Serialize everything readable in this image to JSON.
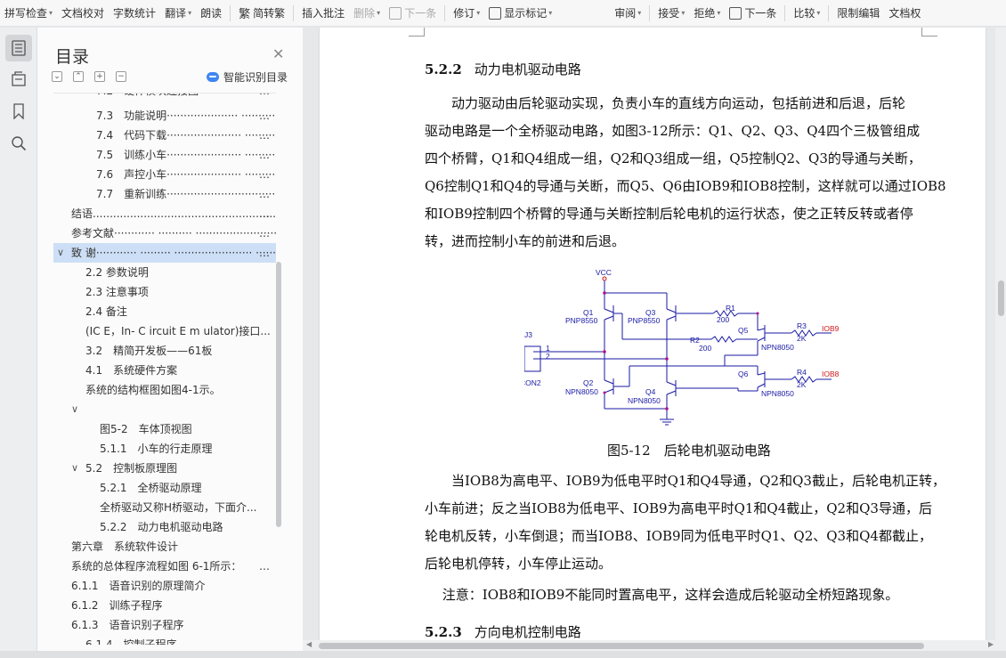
{
  "toolbar": {
    "items": [
      {
        "label": "拼写检查",
        "dropdown": true
      },
      {
        "label": "文档校对",
        "dropdown": false
      },
      {
        "label": "字数统计",
        "dropdown": false
      },
      {
        "label": "翻译",
        "dropdown": true
      },
      {
        "label": "朗读",
        "dropdown": false
      },
      {
        "label": "简转繁",
        "dropdown": false
      },
      {
        "label": "插入批注",
        "dropdown": false
      },
      {
        "label": "删除",
        "dropdown": true
      },
      {
        "label": "下一条",
        "dropdown": false
      },
      {
        "label": "修订",
        "dropdown": true
      },
      {
        "label": "显示标记",
        "dropdown": true
      },
      {
        "label": "审阅",
        "dropdown": true
      },
      {
        "label": "接受",
        "dropdown": true
      },
      {
        "label": "拒绝",
        "dropdown": true
      },
      {
        "label": "下一条",
        "dropdown": false
      },
      {
        "label": "比较",
        "dropdown": true
      },
      {
        "label": "限制编辑",
        "dropdown": false
      },
      {
        "label": "文档权",
        "dropdown": false
      }
    ]
  },
  "rail": {
    "buttons": [
      "toc-icon",
      "navigation-icon",
      "bookmark-icon",
      "search-icon"
    ]
  },
  "toc": {
    "title": "目录",
    "smart_label": "智能识别目录",
    "items": [
      {
        "label": "7.2　硬件模块连接图",
        "dots": "…"
      },
      {
        "label": "7.3　功能说明·····················  ··········",
        "dots": "…"
      },
      {
        "label": "7.4　代码下载······················  ··········",
        "dots": "…"
      },
      {
        "label": "7.5　训练小车······················  ··········",
        "dots": "…"
      },
      {
        "label": "7.6　声控小车······················  ··········",
        "dots": "…"
      },
      {
        "label": "7.7　重新训练··································",
        "dots": "…"
      },
      {
        "label": "结语...........................................................",
        "dots": "…"
      },
      {
        "label": "参考文献············  ··········  ··························",
        "dots": "…"
      },
      {
        "label": "致  谢············  ·········  ·······················  ·········",
        "dots": "…"
      },
      {
        "label": "2.2  参数说明",
        "dots": ""
      },
      {
        "label": "2.3  注意事项",
        "dots": ""
      },
      {
        "label": "2.4  备注",
        "dots": ""
      },
      {
        "label": "(IC E，In- C ircuit E m ulator)接口...",
        "dots": ""
      },
      {
        "label": "3.2　精简开发板——61板",
        "dots": ""
      },
      {
        "label": "4.1　系统硬件方案",
        "dots": ""
      },
      {
        "label": "系统的结构框图如图4-1示。",
        "dots": ""
      },
      {
        "label": "",
        "dots": ""
      },
      {
        "label": "图5-2　车体顶视图",
        "dots": ""
      },
      {
        "label": "5.1.1　小车的行走原理",
        "dots": ""
      },
      {
        "label": "5.2　控制板原理图",
        "dots": ""
      },
      {
        "label": "5.2.1　全桥驱动原理",
        "dots": ""
      },
      {
        "label": "全桥驱动又称H桥驱动，下面介...",
        "dots": ""
      },
      {
        "label": "5.2.2　动力电机驱动电路",
        "dots": ""
      },
      {
        "label": "第六章　系统软件设计",
        "dots": ""
      },
      {
        "label": "系统的总体程序流程如图 6-1所示：",
        "dots": "…"
      },
      {
        "label": "6.1.1　语音识别的原理简介",
        "dots": ""
      },
      {
        "label": "6.1.2　训练子程序",
        "dots": ""
      },
      {
        "label": "6.1.3　语音识别子程序",
        "dots": ""
      },
      {
        "label": "6.1.4　控制子程序",
        "dots": ""
      }
    ]
  },
  "document": {
    "heading_522": {
      "num": "5.2.2",
      "text": "动力电机驱动电路"
    },
    "para1": [
      "　　动力驱动由后轮驱动实现，负责小车的直线方向运动，包括前进和后退，后轮",
      "驱动电路是一个全桥驱动电路，如图3-12所示：Q1、Q2、Q3、Q4四个三极管组成",
      "四个桥臂，Q1和Q4组成一组，Q2和Q3组成一组，Q5控制Q2、Q3的导通与关断，",
      "Q6控制Q1和Q4的导通与关断，而Q5、Q6由IOB9和IOB8控制，这样就可以通过IOB8",
      "和IOB9控制四个桥臂的导通与关断控制后轮电机的运行状态，使之正转反转或者停",
      "转，进而控制小车的前进和后退。"
    ],
    "figure_caption": "图5-12　后轮电机驱动电路",
    "circuit_labels": {
      "vcc": "VCC",
      "j3": "J3",
      "con2": "CON2",
      "pin1": "1",
      "pin2": "2",
      "q1": "Q1",
      "q1_type": "PNP8550",
      "q3": "Q3",
      "q3_type": "PNP8550",
      "q2": "Q2",
      "q2_type": "NPN8050",
      "q4": "Q4",
      "q4_type": "NPN8050",
      "q5": "Q5",
      "q5_type": "NPN8050",
      "q6": "Q6",
      "q6_type": "NPN8050",
      "r1": "R1",
      "r1_val": "200",
      "r2": "R2",
      "r2_val": "200",
      "r3": "R3",
      "r3_val": "2K",
      "r4": "R4",
      "r4_val": "2K",
      "iob9": "IOB9",
      "iob8": "IOB8"
    },
    "para2": [
      "　　当IOB8为高电平、IOB9为低电平时Q1和Q4导通，Q2和Q3截止，后轮电机正转，",
      "小车前进；反之当IOB8为低电平、IOB9为高电平时Q1和Q4截止，Q2和Q3导通，后",
      "轮电机反转，小车倒退；而当IOB8、IOB9同为低电平时Q1、Q2、Q3和Q4都截止，",
      "后轮电机停转，小车停止运动。"
    ],
    "note": "　 注意：IOB8和IOB9不能同时置高电平，这样会造成后轮驱动全桥短路现象。",
    "heading_523": {
      "num": "5.2.3",
      "text": "方向电机控制电路"
    }
  },
  "colors": {
    "circuit_blue": "#1a1aa6",
    "circuit_red": "#d01818",
    "circuit_magenta": "#b0128a",
    "toc_selected": "#cddff6",
    "smart_blue": "#3f86f1"
  }
}
